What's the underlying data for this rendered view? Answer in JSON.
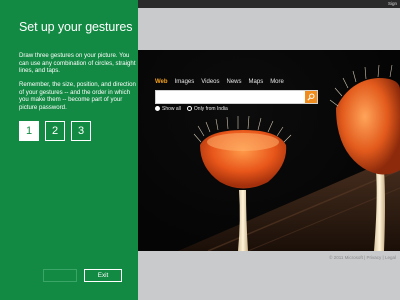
{
  "panel": {
    "title": "Set up your gestures",
    "paragraph1": "Draw three gestures on your picture. You can use any combination of circles, straight lines, and taps.",
    "paragraph2": "Remember, the size, position, and direction of your gestures -- and the order in which you make them -- become part of your picture password.",
    "steps": [
      "1",
      "2",
      "3"
    ],
    "active_step": "1",
    "back_label": "",
    "exit_label": "Exit",
    "accent_color": "#138a43"
  },
  "topbar": {
    "signin_label": "Sign"
  },
  "search": {
    "tabs": [
      "Web",
      "Images",
      "Videos",
      "News",
      "Maps",
      "More"
    ],
    "selected_tab": "Web",
    "input_value": "",
    "options": [
      "Show all",
      "Only from India"
    ],
    "selected_option": "Show all"
  },
  "footer": {
    "text": "© 2011 Microsoft | Privacy | Legal"
  },
  "colors": {
    "accent": "#138a43",
    "search_go": "#f08b1d",
    "selected_tab": "#f7a21a"
  }
}
